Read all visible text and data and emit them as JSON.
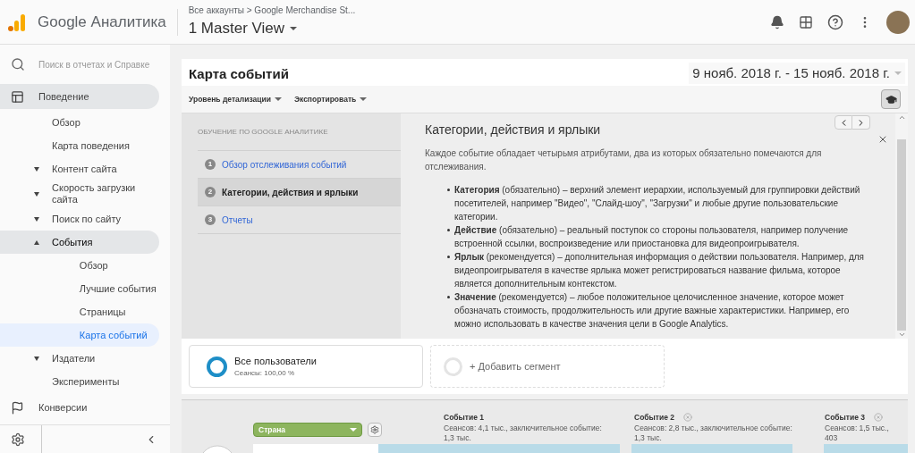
{
  "header": {
    "product": "Google Аналитика",
    "breadcrumb": "Все аккаунты > Google Merchandise St...",
    "view": "1 Master View"
  },
  "sidebar": {
    "search": {
      "placeholder": "Поиск в отчетах и Справке"
    },
    "sections": [
      {
        "label": "Поведение",
        "selected": true,
        "children": [
          {
            "label": "Обзор",
            "kind": "link",
            "selected": false
          },
          {
            "label": "Карта поведения",
            "kind": "link",
            "selected": false
          },
          {
            "label": "Контент сайта",
            "kind": "folder",
            "expanded": false,
            "selected": false
          },
          {
            "label": "Скорость загрузки сайта",
            "kind": "folder",
            "expanded": false,
            "selected": false
          },
          {
            "label": "Поиск по сайту",
            "kind": "folder",
            "expanded": false,
            "selected": false
          },
          {
            "label": "События",
            "kind": "folder",
            "expanded": true,
            "selected": true,
            "children": [
              {
                "label": "Обзор",
                "kind": "link",
                "selected": false
              },
              {
                "label": "Лучшие события",
                "kind": "link",
                "selected": false
              },
              {
                "label": "Страницы",
                "kind": "link",
                "selected": false
              },
              {
                "label": "Карта событий",
                "kind": "link",
                "selected": true
              }
            ]
          },
          {
            "label": "Издатели",
            "kind": "folder",
            "expanded": false,
            "selected": false
          },
          {
            "label": "Эксперименты",
            "kind": "link",
            "selected": false
          }
        ]
      },
      {
        "label": "Конверсии",
        "selected": false
      }
    ]
  },
  "report": {
    "title": "Карта событий",
    "date_range": "9 нояб. 2018 г. - 15 нояб. 2018 г.",
    "toolbar": [
      "Уровень детализации",
      "Экспортировать"
    ],
    "tutorial_on": true
  },
  "tutorial": {
    "heading": "ОБУЧЕНИЕ ПО GOOGLE АНАЛИТИКЕ",
    "steps": [
      {
        "number": "1",
        "label": "Обзор отслеживания событий",
        "selected": false
      },
      {
        "number": "2",
        "label": "Категории, действия и ярлыки",
        "selected": true
      },
      {
        "number": "3",
        "label": "Отчеты",
        "selected": false
      }
    ],
    "title": "Категории, действия и ярлыки",
    "intro": "Каждое событие обладает четырьмя атрибутами, два из которых обязательно помечаются для отслеживания.",
    "bullets": [
      "**Категория** (обязательно) – верхний элемент иерархии, используемый для группировки действий посетителей, например \"Видео\", \"Слайд-шоу\", \"Загрузки\" и любые другие пользовательские категории.",
      "**Действие** (обязательно) – реальный поступок со стороны пользователя, например получение встроенной ссылки, воспроизведение или приостановка для видеопроигрывателя.",
      "**Ярлык** (рекомендуется) – дополнительная информация о действии пользователя. Например, для видеопроигрывателя в качестве ярлыка может регистрироваться название фильма, которое является дополнительным контекстом.",
      "**Значение** (рекомендуется) – любое положительное целочисленное значение, которое может обозначать стоимость, продолжительность или другие важные характеристики. Например, его можно использовать в качестве значения цели в Google Analytics."
    ]
  },
  "segments": [
    {
      "kind": "segment",
      "name": "Все пользователи",
      "detail": "Сеансы: 100,00 %"
    },
    {
      "kind": "add",
      "name": "+ Добавить сегмент"
    }
  ],
  "flow": {
    "dimension": "Страна",
    "events": [
      {
        "name": "Событие 1",
        "removable": false,
        "lines": [
          "Сеансов: 4,1 тыс., заключительное событие:",
          "1,3 тыс."
        ]
      },
      {
        "name": "Событие 2",
        "removable": true,
        "lines": [
          "Сеансов: 2,8 тыс., заключительное событие:",
          "1,3 тыс."
        ]
      },
      {
        "name": "Событие 3",
        "removable": true,
        "lines": [
          "Сеансов: 1,5 тыс.,",
          "403"
        ]
      }
    ]
  }
}
